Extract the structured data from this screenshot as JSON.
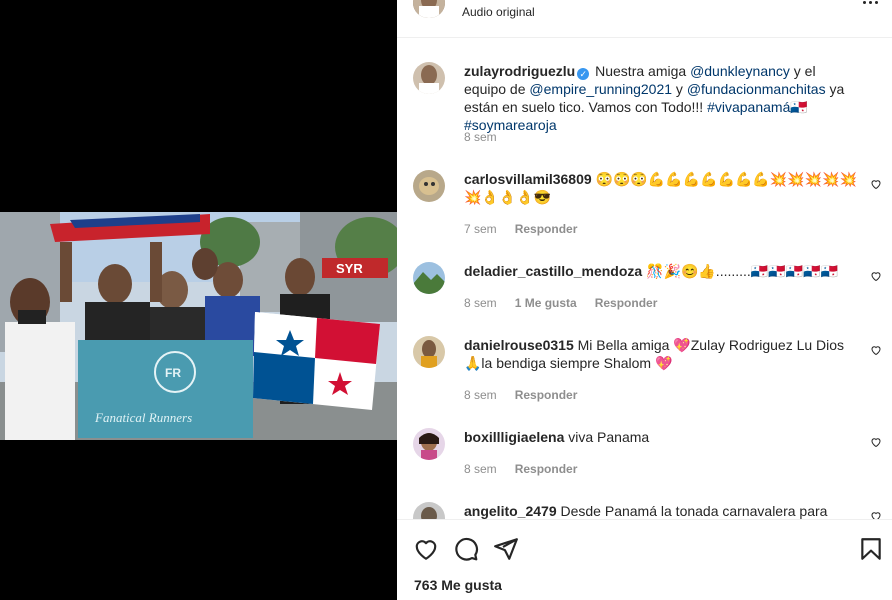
{
  "header": {
    "audio_label": "Audio original"
  },
  "caption": {
    "username": "zulayrodriguezlu",
    "text_1": "Nuestra amiga ",
    "mention_1": "@dunkleynancy",
    "text_2": " y el equipo de ",
    "mention_2": "@empire_running2021",
    "text_3": " y ",
    "mention_3": "@fundacionmanchitas",
    "text_4": " ya están en suelo tico. Vamos con Todo!!! ",
    "tag_1": "#vivapanamá🇵🇦",
    "tag_2": "#soymarearoja",
    "time": "8 sem"
  },
  "comments": [
    {
      "username": "carlosvillamil36809",
      "text": "😳😳😳💪💪💪💪💪💪💪💥💥💥💥💥💥👌👌👌😎",
      "time": "7 sem",
      "likes": "",
      "reply": "Responder"
    },
    {
      "username": "deladier_castillo_mendoza",
      "text": "🎊🎉😊👍.........🇵🇦🇵🇦🇵🇦🇵🇦🇵🇦",
      "time": "8 sem",
      "likes": "1 Me gusta",
      "reply": "Responder"
    },
    {
      "username": "danielrouse0315",
      "text": "Mi Bella amiga 💖Zulay Rodriguez Lu Dios 🙏la bendiga siempre Shalom 💖",
      "time": "8 sem",
      "likes": "",
      "reply": "Responder"
    },
    {
      "username": "boxillligiaelena",
      "text": "viva Panama",
      "time": "8 sem",
      "likes": "",
      "reply": "Responder"
    },
    {
      "username": "angelito_2479",
      "text": "Desde Panamá la tonada carnavalera para",
      "time": "",
      "likes": "",
      "reply": ""
    }
  ],
  "footer": {
    "likes_count": "763 Me gusta"
  },
  "video": {
    "sign_text": "SYR",
    "banner_text": "Fanatical Runners",
    "badge_text": "FR"
  },
  "colors": {
    "link": "#00376b",
    "meta": "#8e8e8e",
    "verified": "#3897f0",
    "flag_red": "#d21034",
    "flag_blue": "#005293",
    "banner_teal": "#4a9bb0"
  },
  "icons": [
    "more-icon",
    "verified-icon",
    "heart-icon",
    "comment-icon",
    "share-icon",
    "bookmark-icon"
  ]
}
